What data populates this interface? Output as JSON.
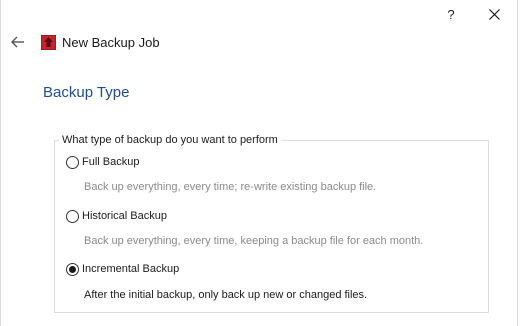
{
  "window": {
    "title": "New Backup Job",
    "help_label": "?"
  },
  "page": {
    "title": "Backup Type"
  },
  "group": {
    "legend": "What type of backup do you want to perform"
  },
  "options": [
    {
      "label": "Full Backup",
      "description": "Back up everything, every time; re-write existing backup file.",
      "selected": false
    },
    {
      "label": "Historical Backup",
      "description": "Back up everything, every time, keeping a backup file for each month.",
      "selected": false
    },
    {
      "label": "Incremental Backup",
      "description": "After the initial backup, only back up new or changed files.",
      "selected": true
    }
  ],
  "colors": {
    "accent_title": "#1f4e8c",
    "app_icon": "#c0262b",
    "muted_text": "#8a8a8a"
  },
  "icons": {
    "back": "back-arrow-icon",
    "app": "backup-app-icon",
    "close": "close-icon"
  }
}
